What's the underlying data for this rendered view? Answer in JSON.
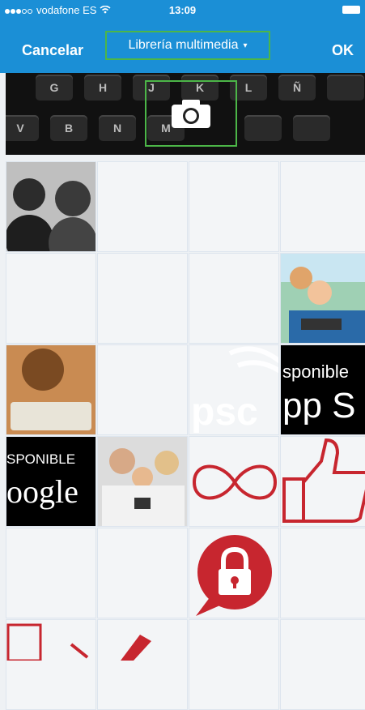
{
  "status": {
    "carrier": "vodafone ES",
    "time": "13:09"
  },
  "nav": {
    "cancel_label": "Cancelar",
    "title": "Librería multimedia",
    "caret": "▾",
    "ok_label": "OK"
  },
  "keyboard_keys": [
    "G",
    "H",
    "J",
    "K",
    "L",
    "Ñ",
    "V",
    "B",
    "N",
    "M"
  ],
  "grid_text": {
    "store_text_1": "sponible",
    "store_text_2": "pp S",
    "psc_text": "psc",
    "google_small": "SPONIBLE",
    "google_big": "oogle"
  },
  "icons": [
    "camera-icon",
    "infinity-icon",
    "thumbs-up-icon",
    "lock-icon",
    "wifi-icon"
  ],
  "colors": {
    "accent": "#1b8fd6",
    "highlight": "#4cb648",
    "icon_red": "#c7262f"
  }
}
